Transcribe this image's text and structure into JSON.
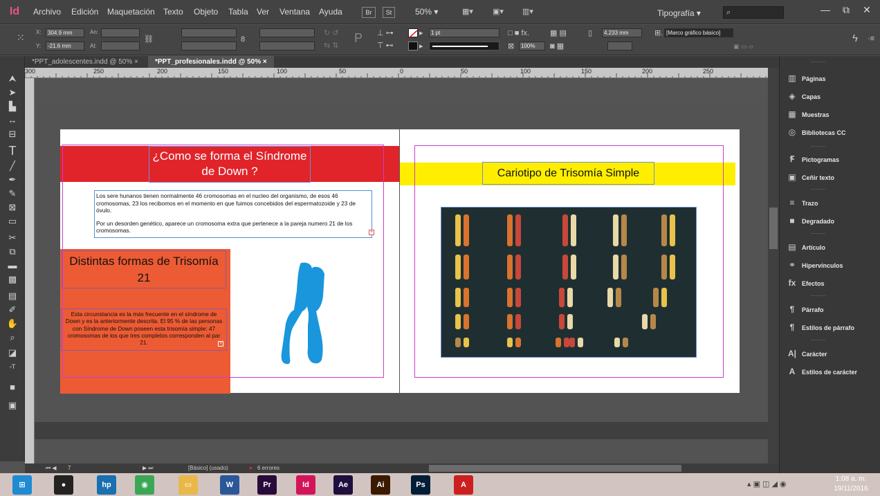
{
  "app": {
    "logo": "Id",
    "menu": [
      "Archivo",
      "Edición",
      "Maquetación",
      "Texto",
      "Objeto",
      "Tabla",
      "Ver",
      "Ventana",
      "Ayuda"
    ],
    "bridge_btn": "Br",
    "stock_btn": "St",
    "zoom": "50% ▾",
    "workspace": "Tipografía ▾",
    "window_buttons": [
      "—",
      "⧉",
      "✕"
    ]
  },
  "control": {
    "x_label": "X:",
    "x_value": "304.9 mm",
    "y_label": "Y:",
    "y_value": "-21.6 mm",
    "w_label": "An:",
    "h_label": "Al:",
    "stroke_weight": "1 pt",
    "opacity": "100%",
    "offset_value": "4.233 mm",
    "frame_style": "[Marco gráfico básico]"
  },
  "tabs": [
    {
      "label": "*PPT_adolescentes.indd @ 50%",
      "close": "×"
    },
    {
      "label": "*PPT_profesionales.indd @ 50%",
      "close": "×"
    }
  ],
  "ruler_labels": [
    "300",
    "250",
    "200",
    "150",
    "100",
    "50",
    "0",
    "50",
    "100",
    "150",
    "200",
    "250"
  ],
  "spread": {
    "left_page": {
      "title": "¿Como se forma el Síndrome de Down ?",
      "para1": "Los sere hunanos tienen normalmente 46 cromosomas en el nucleo del organismo, de esos 46 cromosomas, 23 los recibomos en el momento en que fuimos concebidos del espermatozoide y 23 de óvulo.",
      "para2": "Por un desorden genético, aparece un cromosoma extra que pertenece a la pareja numero 21 de los cromosomas.",
      "box_title": "Distintas formas de Trisomía 21",
      "box_text": "Esta circunstancia es la más frecuente en el síndrome de Down y es la anteriormente descrita. El 95 % de las personas con Síndrome de Down poseen esta trisomía simple: 47 cromosomas de los que tres completos corresponden al par 21."
    },
    "right_page": {
      "title": "Cariotipo de Trisomía Simple"
    }
  },
  "status": {
    "page_number": "7",
    "master": "[Básico] (usado)",
    "errors": "6 errores"
  },
  "panels": [
    {
      "icon": "pages-icon",
      "glyph": "▥",
      "label": "Páginas"
    },
    {
      "icon": "layers-icon",
      "glyph": "◈",
      "label": "Capas"
    },
    {
      "icon": "swatches-icon",
      "glyph": "▦",
      "label": "Muestras"
    },
    {
      "icon": "cc-libraries-icon",
      "glyph": "◎",
      "label": "Bibliotecas CC"
    },
    {
      "icon": "glyphs-icon",
      "glyph": "Ꞙ",
      "label": "Pictogramas"
    },
    {
      "icon": "text-wrap-icon",
      "glyph": "▣",
      "label": "Ceñir texto"
    },
    {
      "icon": "stroke-icon",
      "glyph": "≡",
      "label": "Trazo"
    },
    {
      "icon": "gradient-icon",
      "glyph": "■",
      "label": "Degradado"
    },
    {
      "icon": "article-icon",
      "glyph": "▤",
      "label": "Artículo"
    },
    {
      "icon": "hyperlinks-icon",
      "glyph": "⚭",
      "label": "Hipervínculos"
    },
    {
      "icon": "effects-icon",
      "glyph": "fx",
      "label": "Efectos"
    },
    {
      "icon": "paragraph-icon",
      "glyph": "¶",
      "label": "Párrafo"
    },
    {
      "icon": "paragraph-styles-icon",
      "glyph": "¶",
      "label": "Estilos de párrafo"
    },
    {
      "icon": "character-icon",
      "glyph": "A|",
      "label": "Carácter"
    },
    {
      "icon": "character-styles-icon",
      "glyph": "A",
      "label": "Estilos de carácter"
    }
  ],
  "taskbar": {
    "apps": [
      {
        "name": "start-button",
        "label": "⊞",
        "color": "#1e8bd2"
      },
      {
        "name": "media-player",
        "label": "●",
        "color": "#222222"
      },
      {
        "name": "hp-app",
        "label": "hp",
        "color": "#1a6fb0"
      },
      {
        "name": "chrome",
        "label": "◉",
        "color": "#3aa757"
      },
      {
        "name": "file-explorer",
        "label": "▭",
        "color": "#e9b84a"
      },
      {
        "name": "word",
        "label": "W",
        "color": "#2b579a"
      },
      {
        "name": "premiere",
        "label": "Pr",
        "color": "#2a0a3a"
      },
      {
        "name": "indesign",
        "label": "Id",
        "color": "#d4145a"
      },
      {
        "name": "after-effects",
        "label": "Ae",
        "color": "#1f0f3f"
      },
      {
        "name": "illustrator",
        "label": "Ai",
        "color": "#3a1a00"
      },
      {
        "name": "photoshop",
        "label": "Ps",
        "color": "#001e36"
      },
      {
        "name": "acrobat",
        "label": "A",
        "color": "#cc1f1f"
      }
    ],
    "time": "1:08 a. m.",
    "date": "19/11/2016"
  },
  "colors": {
    "red_band": "#e0242a",
    "orange_box": "#ed5b34",
    "yellow_band": "#ffee00",
    "chromosome_blue": "#1a96dc",
    "margin_guide": "#cc3bcc",
    "frame_edge": "#6f8ed8"
  }
}
